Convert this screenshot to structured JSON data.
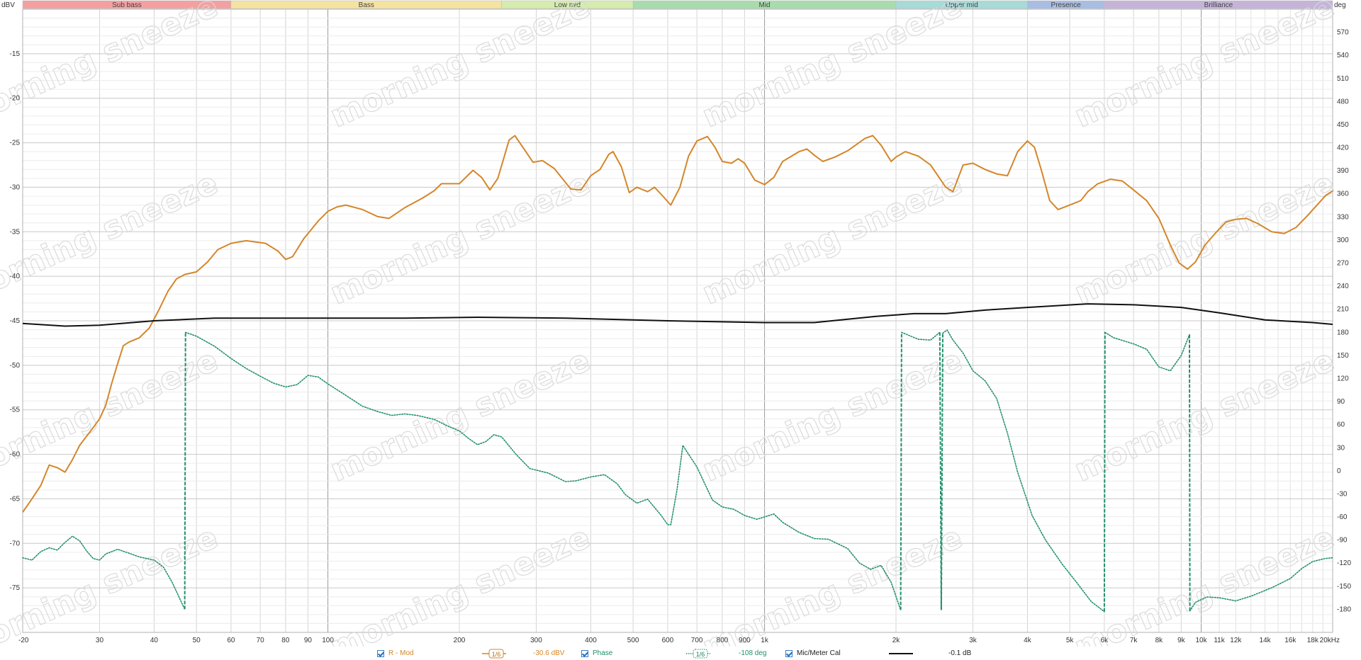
{
  "chart_data": {
    "type": "line",
    "x_scale": "log",
    "xlim": [
      20,
      20000
    ],
    "x_ticks": [
      "-20",
      "30",
      "40",
      "50",
      "60",
      "70",
      "80",
      "90",
      "100",
      "200",
      "300",
      "400",
      "500",
      "600",
      "700",
      "800",
      "900",
      "1k",
      "2k",
      "3k",
      "4k",
      "5k",
      "6k",
      "7k",
      "8k",
      "9k",
      "10k",
      "11k",
      "12k",
      "14k",
      "16k",
      "18k",
      "20kHz"
    ],
    "left_axis": {
      "unit": "dBV",
      "ylim": [
        -80,
        -10
      ],
      "ticks": [
        "-15",
        "-20",
        "-25",
        "-30",
        "-35",
        "-40",
        "-45",
        "-50",
        "-55",
        "-60",
        "-65",
        "-70",
        "-75"
      ]
    },
    "right_axis": {
      "unit": "deg",
      "ylim": [
        -210,
        600
      ],
      "ticks": [
        "570",
        "540",
        "510",
        "480",
        "450",
        "420",
        "390",
        "360",
        "330",
        "300",
        "270",
        "240",
        "210",
        "180",
        "150",
        "120",
        "90",
        "60",
        "30",
        "0",
        "-30",
        "-60",
        "-90",
        "-120",
        "-150",
        "-180"
      ]
    },
    "bands": [
      {
        "name": "Sub bass",
        "from": 20,
        "to": 60,
        "color": "#f4a0a0"
      },
      {
        "name": "Bass",
        "from": 60,
        "to": 250,
        "color": "#f5e3a0"
      },
      {
        "name": "Low mid",
        "from": 250,
        "to": 500,
        "color": "#d5ecad"
      },
      {
        "name": "Mid",
        "from": 500,
        "to": 2000,
        "color": "#a8dcac"
      },
      {
        "name": "Upper mid",
        "from": 2000,
        "to": 4000,
        "color": "#a6dbd8"
      },
      {
        "name": "Presence",
        "from": 4000,
        "to": 6000,
        "color": "#a7bde3"
      },
      {
        "name": "Brilliance",
        "from": 6000,
        "to": 20000,
        "color": "#c5b3da"
      }
    ],
    "grid": true,
    "series": [
      {
        "name": "R - Mod",
        "axis": "left",
        "color": "#d4862a",
        "style": "solid",
        "points": [
          [
            20,
            -66.5
          ],
          [
            21,
            -65
          ],
          [
            22,
            -63.5
          ],
          [
            23,
            -61.2
          ],
          [
            24,
            -61.5
          ],
          [
            25,
            -62
          ],
          [
            26,
            -60.6
          ],
          [
            27,
            -59
          ],
          [
            29,
            -57
          ],
          [
            30,
            -56
          ],
          [
            31,
            -54.5
          ],
          [
            32,
            -52
          ],
          [
            33,
            -49.8
          ],
          [
            34,
            -47.8
          ],
          [
            35,
            -47.4
          ],
          [
            37,
            -46.9
          ],
          [
            39,
            -45.8
          ],
          [
            41,
            -43.8
          ],
          [
            43,
            -41.7
          ],
          [
            45,
            -40.3
          ],
          [
            47,
            -39.8
          ],
          [
            50,
            -39.5
          ],
          [
            53,
            -38.4
          ],
          [
            56,
            -37
          ],
          [
            60,
            -36.3
          ],
          [
            65,
            -36
          ],
          [
            72,
            -36.3
          ],
          [
            77,
            -37.2
          ],
          [
            80,
            -38.1
          ],
          [
            83,
            -37.8
          ],
          [
            88,
            -35.8
          ],
          [
            95,
            -33.8
          ],
          [
            100,
            -32.7
          ],
          [
            105,
            -32.2
          ],
          [
            110,
            -32
          ],
          [
            120,
            -32.5
          ],
          [
            130,
            -33.3
          ],
          [
            138,
            -33.5
          ],
          [
            150,
            -32.3
          ],
          [
            165,
            -31.2
          ],
          [
            175,
            -30.4
          ],
          [
            182,
            -29.6
          ],
          [
            200,
            -29.6
          ],
          [
            215,
            -28.1
          ],
          [
            225,
            -28.9
          ],
          [
            235,
            -30.3
          ],
          [
            245,
            -29
          ],
          [
            260,
            -24.7
          ],
          [
            268,
            -24.2
          ],
          [
            285,
            -26.1
          ],
          [
            295,
            -27.2
          ],
          [
            310,
            -27
          ],
          [
            330,
            -27.9
          ],
          [
            360,
            -30.2
          ],
          [
            380,
            -30.3
          ],
          [
            400,
            -28.7
          ],
          [
            420,
            -28
          ],
          [
            440,
            -26.3
          ],
          [
            450,
            -26
          ],
          [
            470,
            -27.7
          ],
          [
            490,
            -30.6
          ],
          [
            510,
            -30
          ],
          [
            540,
            -30.5
          ],
          [
            560,
            -30
          ],
          [
            590,
            -31.2
          ],
          [
            610,
            -32
          ],
          [
            640,
            -30
          ],
          [
            670,
            -26.5
          ],
          [
            700,
            -24.8
          ],
          [
            740,
            -24.3
          ],
          [
            770,
            -25.5
          ],
          [
            800,
            -27.1
          ],
          [
            840,
            -27.3
          ],
          [
            870,
            -26.8
          ],
          [
            900,
            -27.3
          ],
          [
            950,
            -29.2
          ],
          [
            1000,
            -29.7
          ],
          [
            1050,
            -28.9
          ],
          [
            1100,
            -27.1
          ],
          [
            1200,
            -26
          ],
          [
            1250,
            -25.7
          ],
          [
            1300,
            -26.4
          ],
          [
            1360,
            -27.1
          ],
          [
            1450,
            -26.6
          ],
          [
            1550,
            -25.9
          ],
          [
            1700,
            -24.5
          ],
          [
            1770,
            -24.2
          ],
          [
            1850,
            -25.3
          ],
          [
            1950,
            -27.1
          ],
          [
            2000,
            -26.6
          ],
          [
            2100,
            -26
          ],
          [
            2250,
            -26.5
          ],
          [
            2400,
            -27.5
          ],
          [
            2600,
            -30
          ],
          [
            2700,
            -30.5
          ],
          [
            2850,
            -27.5
          ],
          [
            3000,
            -27.3
          ],
          [
            3200,
            -28
          ],
          [
            3400,
            -28.5
          ],
          [
            3600,
            -28.7
          ],
          [
            3800,
            -26
          ],
          [
            4000,
            -24.8
          ],
          [
            4150,
            -25.5
          ],
          [
            4300,
            -28
          ],
          [
            4500,
            -31.5
          ],
          [
            4700,
            -32.5
          ],
          [
            5000,
            -32
          ],
          [
            5300,
            -31.5
          ],
          [
            5500,
            -30.5
          ],
          [
            5800,
            -29.6
          ],
          [
            6200,
            -29.1
          ],
          [
            6600,
            -29.3
          ],
          [
            7000,
            -30.3
          ],
          [
            7500,
            -31.5
          ],
          [
            8000,
            -33.5
          ],
          [
            8500,
            -36.5
          ],
          [
            8900,
            -38.5
          ],
          [
            9300,
            -39.2
          ],
          [
            9700,
            -38.4
          ],
          [
            10200,
            -36.5
          ],
          [
            10800,
            -35.1
          ],
          [
            11400,
            -33.9
          ],
          [
            12000,
            -33.6
          ],
          [
            12700,
            -33.5
          ],
          [
            13500,
            -34.1
          ],
          [
            14500,
            -35
          ],
          [
            15500,
            -35.2
          ],
          [
            16500,
            -34.5
          ],
          [
            17500,
            -33.2
          ],
          [
            18500,
            -31.9
          ],
          [
            19300,
            -30.9
          ],
          [
            20000,
            -30.4
          ]
        ]
      },
      {
        "name": "Phase",
        "axis": "right",
        "color": "#22906a",
        "style": "dotted",
        "points": [
          [
            20,
            -113
          ],
          [
            21,
            -116
          ],
          [
            22,
            -105
          ],
          [
            23,
            -100
          ],
          [
            24,
            -103
          ],
          [
            25,
            -93
          ],
          [
            26,
            -85
          ],
          [
            27,
            -91
          ],
          [
            28,
            -104
          ],
          [
            29,
            -114
          ],
          [
            30,
            -116
          ],
          [
            31,
            -108
          ],
          [
            33,
            -102
          ],
          [
            35,
            -107
          ],
          [
            37,
            -112
          ],
          [
            40,
            -116
          ],
          [
            42,
            -125
          ],
          [
            44,
            -145
          ],
          [
            47,
            -180
          ],
          [
            47.2,
            180
          ],
          [
            50,
            175
          ],
          [
            55,
            162
          ],
          [
            60,
            146
          ],
          [
            65,
            133
          ],
          [
            70,
            123
          ],
          [
            75,
            114
          ],
          [
            80,
            109
          ],
          [
            85,
            112
          ],
          [
            90,
            124
          ],
          [
            95,
            122
          ],
          [
            100,
            113
          ],
          [
            110,
            98
          ],
          [
            120,
            84
          ],
          [
            130,
            77
          ],
          [
            140,
            72
          ],
          [
            150,
            74
          ],
          [
            160,
            72
          ],
          [
            175,
            67
          ],
          [
            190,
            57
          ],
          [
            200,
            52
          ],
          [
            210,
            42
          ],
          [
            220,
            34
          ],
          [
            230,
            38
          ],
          [
            240,
            47
          ],
          [
            250,
            44
          ],
          [
            270,
            21
          ],
          [
            290,
            3
          ],
          [
            320,
            -3
          ],
          [
            350,
            -14
          ],
          [
            370,
            -13
          ],
          [
            400,
            -8
          ],
          [
            430,
            -5
          ],
          [
            460,
            -17
          ],
          [
            480,
            -31
          ],
          [
            510,
            -42
          ],
          [
            540,
            -37
          ],
          [
            580,
            -58
          ],
          [
            600,
            -70
          ],
          [
            610,
            -70
          ],
          [
            630,
            -25
          ],
          [
            650,
            33
          ],
          [
            700,
            5
          ],
          [
            760,
            -38
          ],
          [
            800,
            -47
          ],
          [
            850,
            -50
          ],
          [
            900,
            -58
          ],
          [
            960,
            -63
          ],
          [
            1000,
            -60
          ],
          [
            1050,
            -56
          ],
          [
            1100,
            -67
          ],
          [
            1200,
            -80
          ],
          [
            1300,
            -88
          ],
          [
            1400,
            -89
          ],
          [
            1550,
            -101
          ],
          [
            1650,
            -120
          ],
          [
            1750,
            -128
          ],
          [
            1850,
            -123
          ],
          [
            1950,
            -145
          ],
          [
            2050,
            -181
          ],
          [
            2060,
            180
          ],
          [
            2250,
            171
          ],
          [
            2400,
            170
          ],
          [
            2520,
            180
          ],
          [
            2540,
            -181
          ],
          [
            2560,
            179
          ],
          [
            2620,
            183
          ],
          [
            2700,
            170
          ],
          [
            2850,
            153
          ],
          [
            3000,
            130
          ],
          [
            3200,
            117
          ],
          [
            3400,
            94
          ],
          [
            3600,
            49
          ],
          [
            3800,
            -2
          ],
          [
            4100,
            -58
          ],
          [
            4400,
            -90
          ],
          [
            4800,
            -121
          ],
          [
            5200,
            -146
          ],
          [
            5600,
            -170
          ],
          [
            6000,
            -183
          ],
          [
            6020,
            180
          ],
          [
            6300,
            173
          ],
          [
            7000,
            165
          ],
          [
            7500,
            158
          ],
          [
            8000,
            135
          ],
          [
            8500,
            130
          ],
          [
            9000,
            150
          ],
          [
            9400,
            177
          ],
          [
            9420,
            -182
          ],
          [
            9700,
            -171
          ],
          [
            10300,
            -164
          ],
          [
            11000,
            -165
          ],
          [
            12000,
            -169
          ],
          [
            13000,
            -163
          ],
          [
            14500,
            -152
          ],
          [
            16000,
            -140
          ],
          [
            17000,
            -127
          ],
          [
            18000,
            -118
          ],
          [
            19200,
            -114
          ],
          [
            20000,
            -113
          ]
        ]
      },
      {
        "name": "Mic/Meter Cal",
        "axis": "left",
        "color": "#111111",
        "style": "solid",
        "points": [
          [
            20,
            -45.3
          ],
          [
            25,
            -45.6
          ],
          [
            30,
            -45.5
          ],
          [
            40,
            -45.0
          ],
          [
            55,
            -44.7
          ],
          [
            80,
            -44.7
          ],
          [
            150,
            -44.7
          ],
          [
            220,
            -44.6
          ],
          [
            350,
            -44.7
          ],
          [
            600,
            -45.0
          ],
          [
            1000,
            -45.2
          ],
          [
            1300,
            -45.2
          ],
          [
            1800,
            -44.5
          ],
          [
            2200,
            -44.2
          ],
          [
            2600,
            -44.2
          ],
          [
            3200,
            -43.8
          ],
          [
            4000,
            -43.5
          ],
          [
            5500,
            -43.1
          ],
          [
            7000,
            -43.2
          ],
          [
            9000,
            -43.5
          ],
          [
            11000,
            -44.1
          ],
          [
            14000,
            -44.9
          ],
          [
            18000,
            -45.2
          ],
          [
            20000,
            -45.4
          ]
        ]
      }
    ]
  },
  "legend": {
    "rmod_label": "R - Mod",
    "rmod_smoothing": "1/6",
    "rmod_value": "-30.6 dBV",
    "phase_label": "Phase",
    "phase_smoothing": "1/6",
    "phase_value": "-108 deg",
    "cal_label": "Mic/Meter Cal",
    "cal_value": "-0.1 dB"
  },
  "watermark_text": "morning sneeze"
}
